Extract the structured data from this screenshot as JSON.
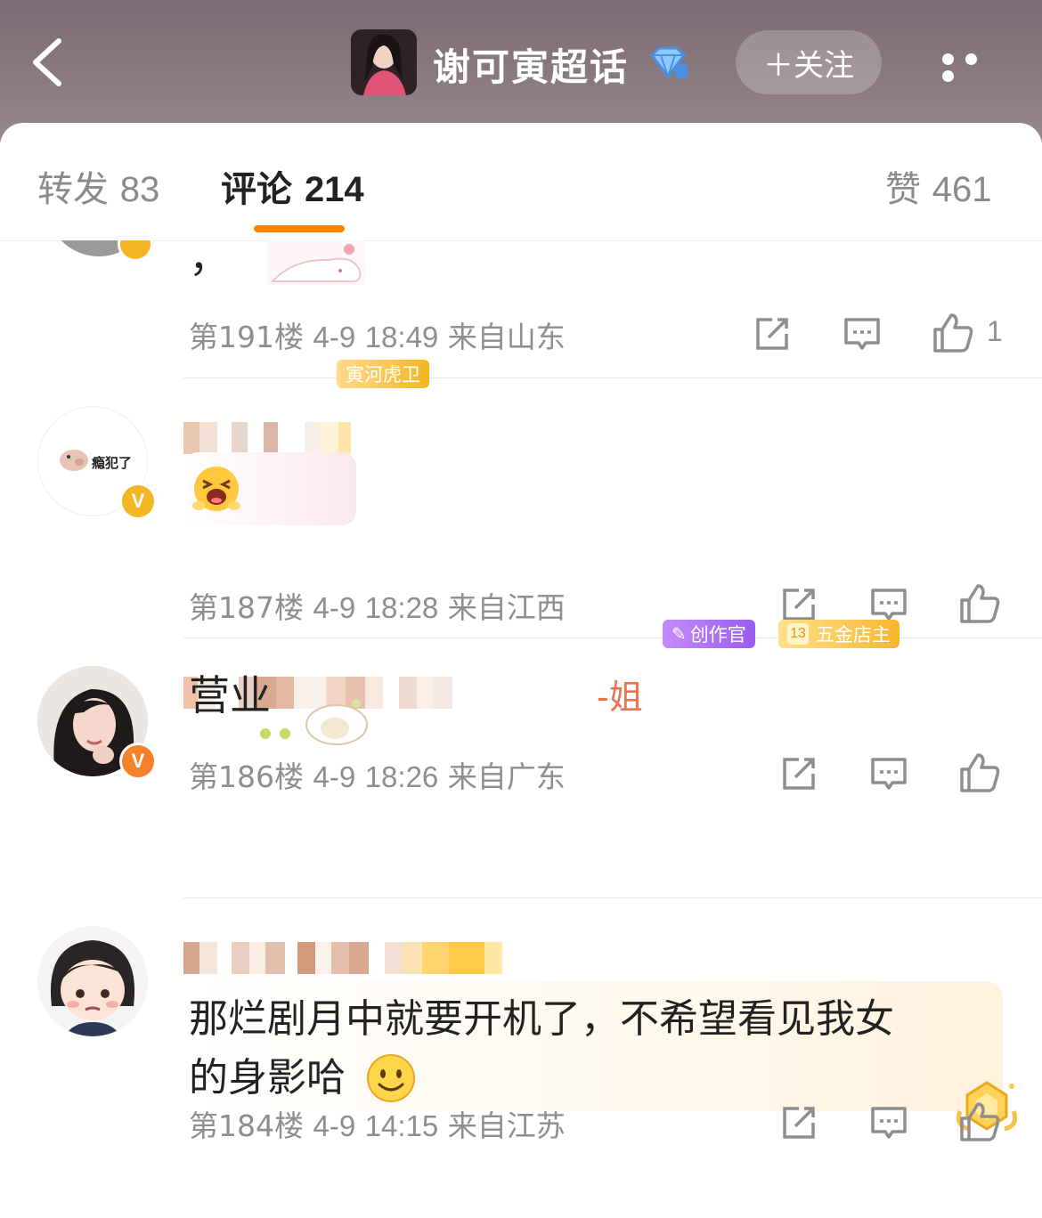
{
  "header": {
    "topic_title": "谢可寅超话",
    "follow_label": "＋关注"
  },
  "tabs": [
    {
      "label": "转发",
      "count": "83"
    },
    {
      "label": "评论",
      "count": "214"
    },
    {
      "label": "赞",
      "count": "461"
    }
  ],
  "comments": [
    {
      "text": "，",
      "floor": "第191楼",
      "date": "4-9",
      "time": "18:49",
      "location": "来自山东",
      "likes": "1"
    },
    {
      "avatar_text": "瘾犯了",
      "badge": "寅河虎卫",
      "text": "",
      "floor": "第187楼",
      "date": "4-9",
      "time": "18:28",
      "location": "来自江西",
      "likes": ""
    },
    {
      "name_suffix": "-姐",
      "badge1": "创作官",
      "badge2_level": "13",
      "badge2": "五金店主",
      "text": "营业",
      "floor": "第186楼",
      "date": "4-9",
      "time": "18:26",
      "location": "来自广东",
      "likes": ""
    },
    {
      "text_line1": "那烂剧月中就要开机了，不希望看见我女",
      "text_line2": "的身影哈",
      "floor": "第184楼",
      "date": "4-9",
      "time": "14:15",
      "location": "来自江苏",
      "likes": ""
    }
  ],
  "colors": {
    "accent": "#ff8200",
    "badge_gold": "#f5b623",
    "badge_purple": "#a46bf0",
    "meta_gray": "#8e8e8e"
  }
}
